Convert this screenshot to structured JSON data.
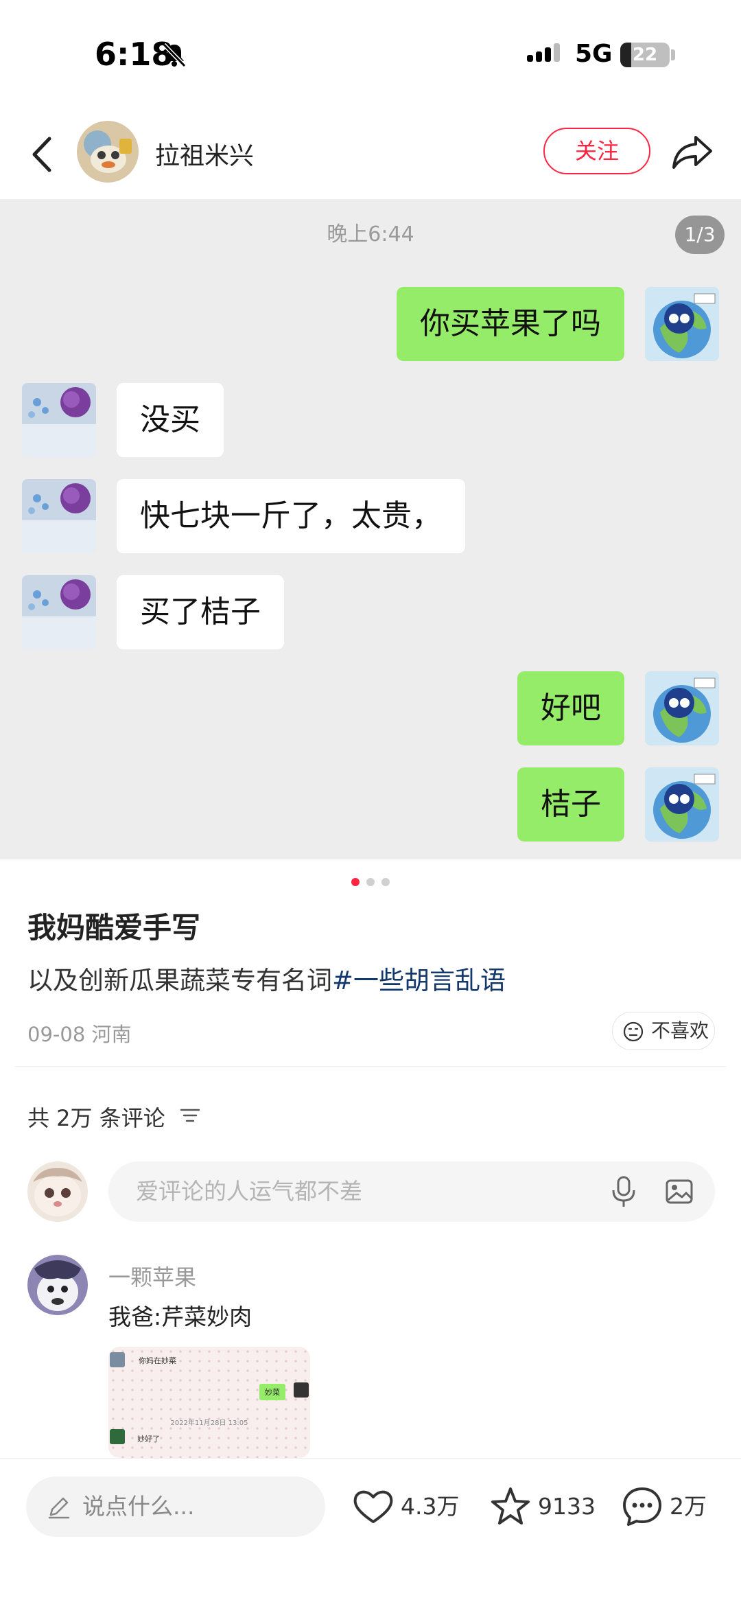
{
  "status_bar": {
    "time": "6:18",
    "network": "5G",
    "battery": "22",
    "battery_level_pct": 22
  },
  "header": {
    "author_name": "拉祖米兴",
    "follow_label": "关注"
  },
  "chat_screenshot": {
    "timestamp": "晚上6:44",
    "page_indicator": "1/3",
    "messages": [
      {
        "side": "me",
        "text": "你买苹果了吗"
      },
      {
        "side": "other",
        "text": "没买"
      },
      {
        "side": "other",
        "text": "快七块一斤了，太贵，"
      },
      {
        "side": "other",
        "text": "买了桔子"
      },
      {
        "side": "me",
        "text": "好吧"
      },
      {
        "side": "me",
        "text": "桔子"
      }
    ]
  },
  "carousel": {
    "count": 3,
    "active": 0
  },
  "note": {
    "title": "我妈酷爱手写",
    "description": "以及创新瓜果蔬菜专有名词",
    "hashtag": "#一些胡言乱语",
    "date": "09-08",
    "location": "河南",
    "dislike_label": "不喜欢"
  },
  "comments": {
    "count_label": "共 2万 条评论",
    "input_placeholder": "爱评论的人运气都不差",
    "items": [
      {
        "username": "一颗苹果",
        "text": "我爸:芹菜妙肉",
        "image": {
          "top_line": "你妈在妙菜",
          "bubble": "妙菜",
          "time": "2022年11月28日 13:05",
          "bottom_line": "妙好了"
        }
      }
    ]
  },
  "bottom_bar": {
    "input_placeholder": "说点什么...",
    "likes": "4.3万",
    "collects": "9133",
    "comments": "2万"
  },
  "colors": {
    "brand_red": "#ff2442",
    "chat_green": "#95ec69",
    "hashtag_blue": "#13386c",
    "chat_bg": "#ededed"
  }
}
